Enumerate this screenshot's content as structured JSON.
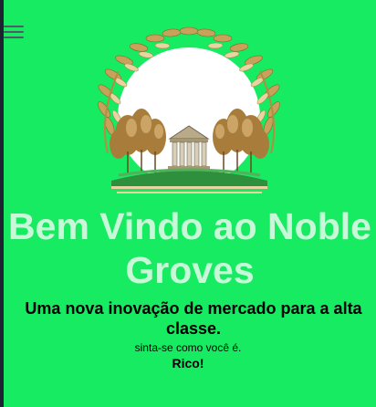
{
  "header": {
    "menu_icon": "hamburger-menu-icon"
  },
  "logo": {
    "icon": "laurel-wreath-temple-logo",
    "colors": {
      "gold": "#c8a25a",
      "gold_light": "#e8d3a2",
      "tree_brown": "#a87d3c",
      "temple": "#b9aa8a",
      "inner_white": "#ffffff"
    }
  },
  "hero": {
    "title": "Bem Vindo ao Noble Groves",
    "subtitle": "Uma nova inovação de mercado para a alta classe.",
    "tagline": "sinta-se como você é.",
    "tagline_strong": "Rico!"
  },
  "colors": {
    "background": "#16eb61",
    "title": "#c9f8d9",
    "sidebar_strip": "#1d2330"
  }
}
